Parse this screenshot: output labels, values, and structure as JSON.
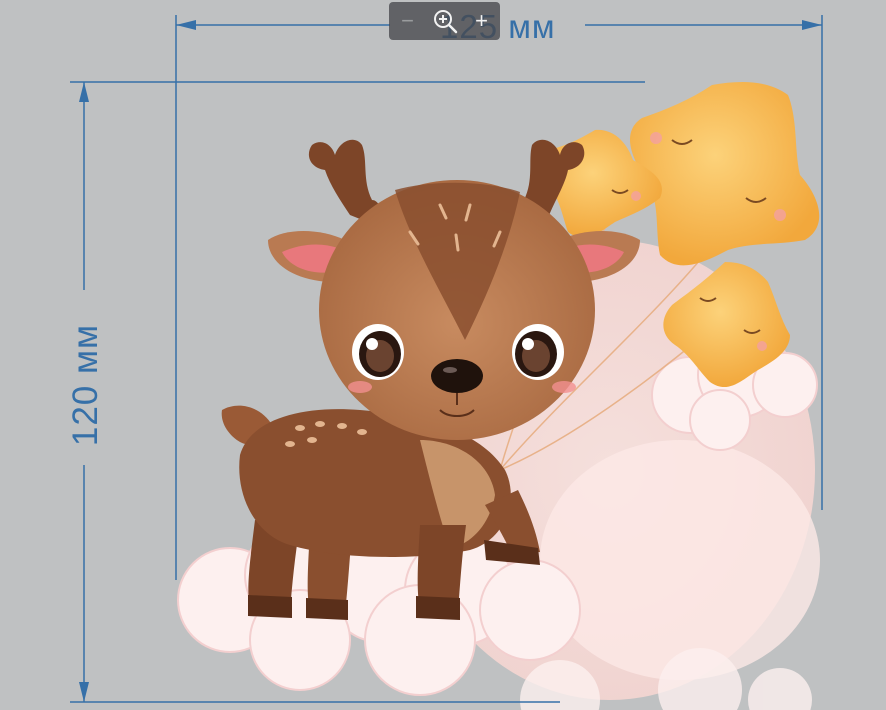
{
  "dimensions": {
    "width_label": "125 мм",
    "height_label": "120 мм"
  },
  "zoom_bar": {
    "zoom_out_symbol": "−",
    "zoom_in_symbol": "+",
    "zoom_icon": "magnifier-plus-icon"
  },
  "colors": {
    "background": "#bfc1c2",
    "dimension_lines": "#3670a8",
    "deer_body": "#8a4f2f",
    "deer_face": "#b97a52",
    "stars": "#f6b74a",
    "clouds": "#fbe6e6"
  }
}
